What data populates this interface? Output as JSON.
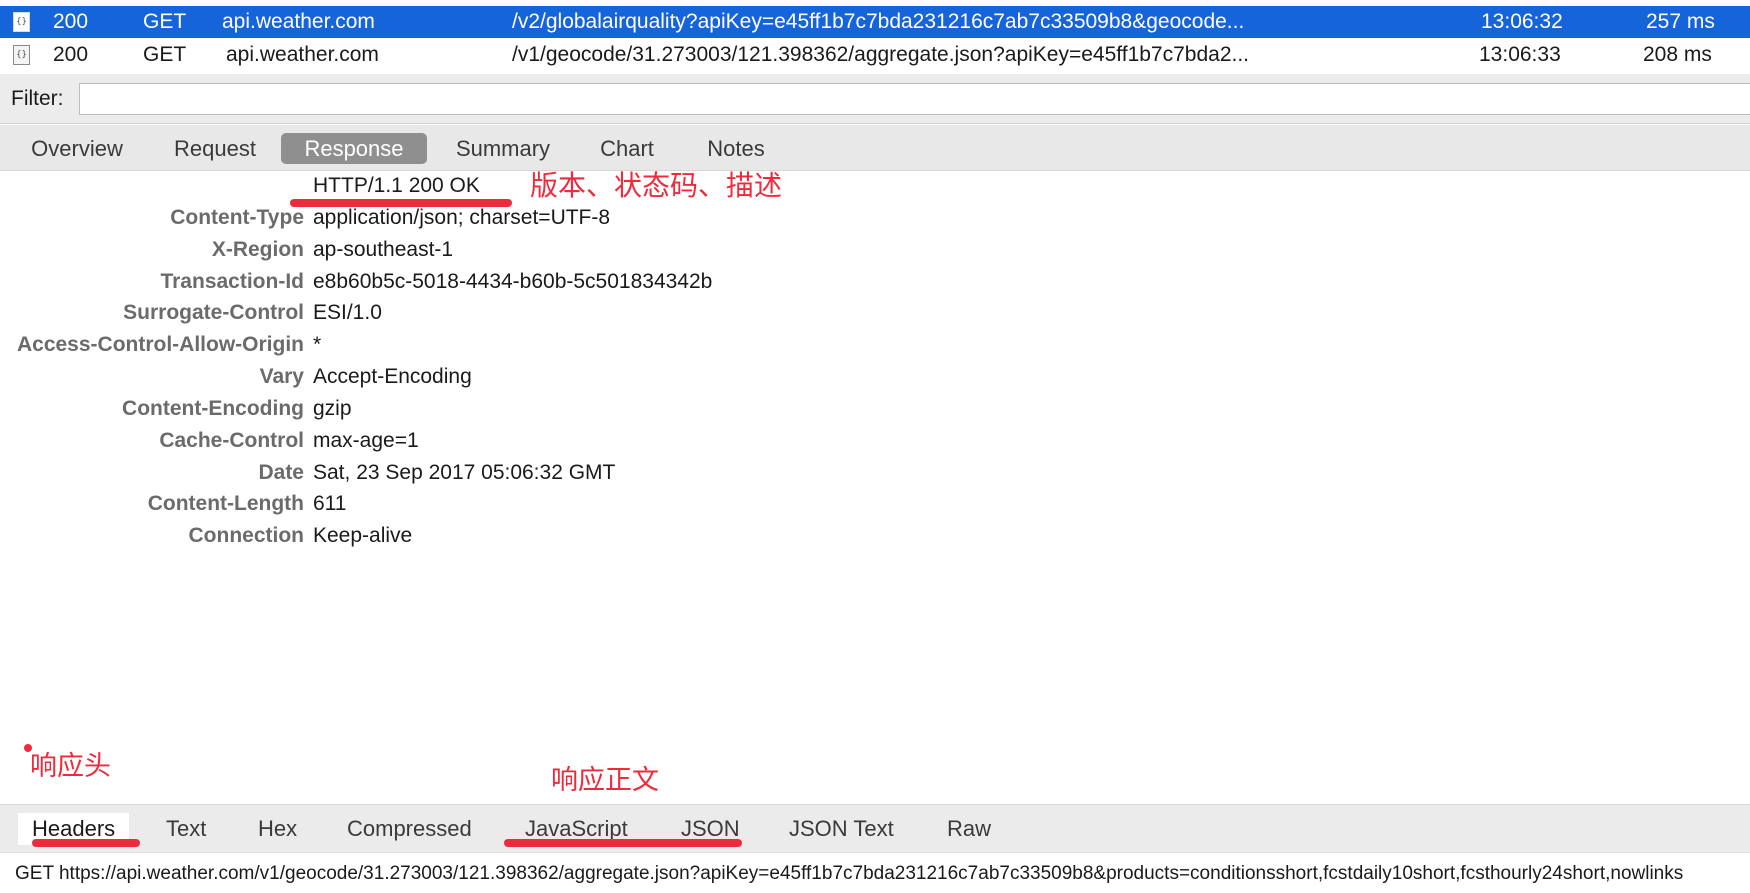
{
  "requests": [
    {
      "icon": "{}",
      "code": "200",
      "method": "GET",
      "host": "api.weather.com",
      "path": "/v2/globalairquality?apiKey=e45ff1b7c7bda231216c7ab7c33509b8&geocode...",
      "time": "13:06:32",
      "duration": "257 ms",
      "selected": true
    },
    {
      "icon": "{}",
      "code": "200",
      "method": "GET",
      "host": "api.weather.com",
      "path": "/v1/geocode/31.273003/121.398362/aggregate.json?apiKey=e45ff1b7c7bda2...",
      "time": "13:06:33",
      "duration": "208 ms",
      "selected": false
    }
  ],
  "filter": {
    "label": "Filter:",
    "value": ""
  },
  "tabs": [
    "Overview",
    "Request",
    "Response",
    "Summary",
    "Chart",
    "Notes"
  ],
  "active_tab": "Response",
  "response": {
    "status_line": "HTTP/1.1 200 OK",
    "headers": [
      {
        "name": "Content-Type",
        "value": "application/json; charset=UTF-8"
      },
      {
        "name": "X-Region",
        "value": "ap-southeast-1"
      },
      {
        "name": "Transaction-Id",
        "value": "e8b60b5c-5018-4434-b60b-5c501834342b"
      },
      {
        "name": "Surrogate-Control",
        "value": "ESI/1.0"
      },
      {
        "name": "Access-Control-Allow-Origin",
        "value": "*"
      },
      {
        "name": "Vary",
        "value": "Accept-Encoding"
      },
      {
        "name": "Content-Encoding",
        "value": "gzip"
      },
      {
        "name": "Cache-Control",
        "value": "max-age=1"
      },
      {
        "name": "Date",
        "value": "Sat, 23 Sep 2017 05:06:32 GMT"
      },
      {
        "name": "Content-Length",
        "value": "611"
      },
      {
        "name": "Connection",
        "value": "Keep-alive"
      }
    ]
  },
  "annotations": {
    "status": "版本、状态码、描述",
    "headers": "响应头",
    "body": "响应正文"
  },
  "bottom_tabs": [
    "Headers",
    "Text",
    "Hex",
    "Compressed",
    "JavaScript",
    "JSON",
    "JSON Text",
    "Raw"
  ],
  "active_bottom_tab": "Headers",
  "status_bar": "GET https://api.weather.com/v1/geocode/31.273003/121.398362/aggregate.json?apiKey=e45ff1b7c7bda231216c7ab7c33509b8&products=conditionsshort,fcstdaily10short,fcsthourly24short,nowlinks",
  "colors": {
    "selection": "#1664d9",
    "annotation": "#ee2a3c",
    "active_tab": "#8f8f8f",
    "header_name": "#6b6b6b"
  }
}
